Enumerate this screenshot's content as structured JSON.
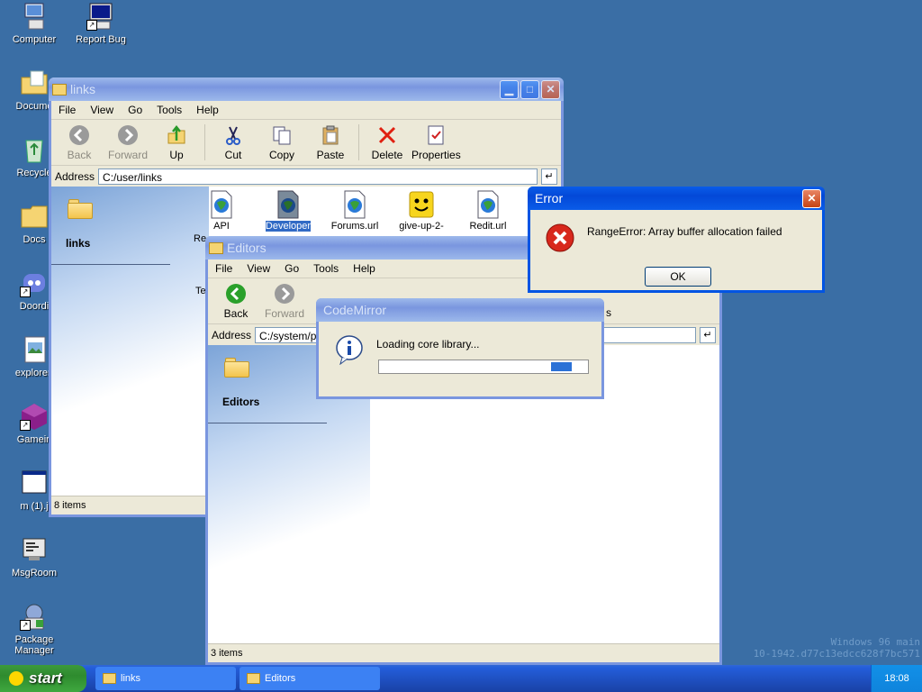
{
  "desktop": {
    "icons": [
      {
        "label": "Computer",
        "icon": "computer-icon"
      },
      {
        "label": "Report Bug",
        "icon": "report-bug-icon"
      },
      {
        "label": "Docume",
        "icon": "documents-folder-icon"
      },
      {
        "label": "Recycle",
        "icon": "recycle-bin-icon"
      },
      {
        "label": "Docs",
        "icon": "folder-icon"
      },
      {
        "label": "Doordi",
        "icon": "discord-icon"
      },
      {
        "label": "explorer.",
        "icon": "image-file-icon"
      },
      {
        "label": "Gamein",
        "icon": "game-cube-icon"
      },
      {
        "label": "m (1).j",
        "icon": "window-file-icon"
      },
      {
        "label": "MsgRoom",
        "icon": "msgroom-icon"
      },
      {
        "label": "Package Manager",
        "icon": "package-manager-icon"
      }
    ],
    "watermark_line1": "Windows 96 main",
    "watermark_line2": "10-1942.d77c13edcc628f7bc571"
  },
  "links_window": {
    "title": "links",
    "menu": [
      "File",
      "View",
      "Go",
      "Tools",
      "Help"
    ],
    "toolbar": {
      "back": "Back",
      "forward": "Forward",
      "up": "Up",
      "cut": "Cut",
      "copy": "Copy",
      "paste": "Paste",
      "delete": "Delete",
      "properties": "Properties"
    },
    "address_label": "Address",
    "address_value": "C:/user/links",
    "sidebar_title": "links",
    "files": [
      {
        "name": "API",
        "icon": "url-file-icon"
      },
      {
        "name": "Developer",
        "icon": "url-file-icon",
        "selected": true
      },
      {
        "name": "Forums.url",
        "icon": "url-file-icon"
      },
      {
        "name": "give-up-2-",
        "icon": "smiley-icon"
      },
      {
        "name": "Redit.url",
        "icon": "url-file-icon"
      }
    ],
    "partial_left_labels": [
      "Re",
      "Te"
    ],
    "status": "8 items"
  },
  "editors_window": {
    "title": "Editors",
    "menu": [
      "File",
      "View",
      "Go",
      "Tools",
      "Help"
    ],
    "toolbar": {
      "back": "Back",
      "forward": "Forward",
      "properties_tail": "s"
    },
    "address_label": "Address",
    "address_value": "C:/system/pro",
    "sidebar_title": "Editors",
    "status": "3 items"
  },
  "codemirror_dialog": {
    "title": "CodeMirror",
    "message": "Loading core library...",
    "progress_fraction": 0.1
  },
  "error_dialog": {
    "title": "Error",
    "message": "RangeError: Array buffer allocation failed",
    "ok_label": "OK"
  },
  "taskbar": {
    "start_label": "start",
    "tasks": [
      {
        "label": "links"
      },
      {
        "label": "Editors"
      }
    ],
    "clock": "18:08"
  },
  "colors": {
    "desktop": "#3a6ea5",
    "titlebar_active": "#0348d8",
    "error_red": "#d8281c",
    "progress_fill": "#2b71d6"
  }
}
